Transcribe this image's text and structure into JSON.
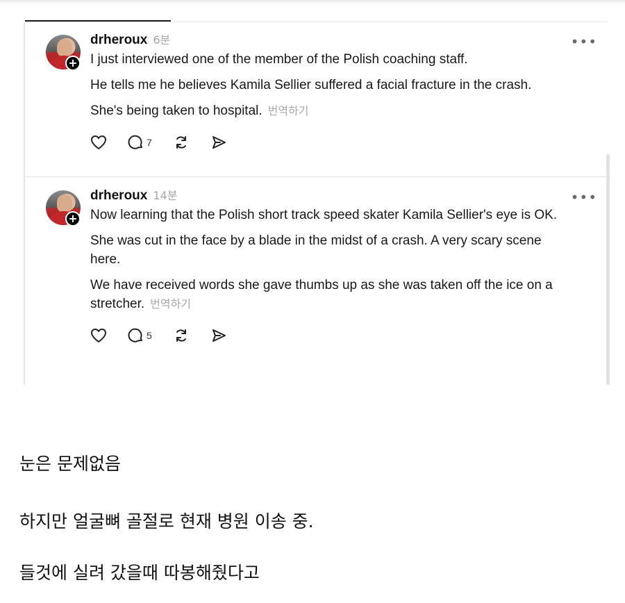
{
  "thread": {
    "posts": [
      {
        "username": "drheroux",
        "time": "6분",
        "paragraphs": [
          "I just interviewed one of the member of the Polish coaching staff.",
          "He tells me he believes Kamila Sellier suffered a facial fracture in the crash.",
          "She's being taken to hospital."
        ],
        "translate": "번역하기",
        "reply_count": "7"
      },
      {
        "username": "drheroux",
        "time": "14분",
        "paragraphs": [
          "Now learning that the Polish short track speed skater Kamila Sellier's eye is OK.",
          "She was cut in the face by a blade in the midst of a crash. A very scary scene here.",
          "We have received words she gave thumbs up as she was taken off the ice on a stretcher."
        ],
        "translate": "번역하기",
        "reply_count": "5"
      }
    ]
  },
  "comment": {
    "lines": [
      "눈은 문제없음",
      "하지만 얼굴뼈 골절로 현재 병원 이송 중.",
      "들것에 실려 갔을때 따봉해줬다고"
    ]
  },
  "icons": {
    "more": "more-horizontal-icon",
    "like": "heart-icon",
    "reply": "comment-bubble-icon",
    "repost": "repost-icon",
    "share": "send-icon",
    "follow": "plus-icon"
  }
}
